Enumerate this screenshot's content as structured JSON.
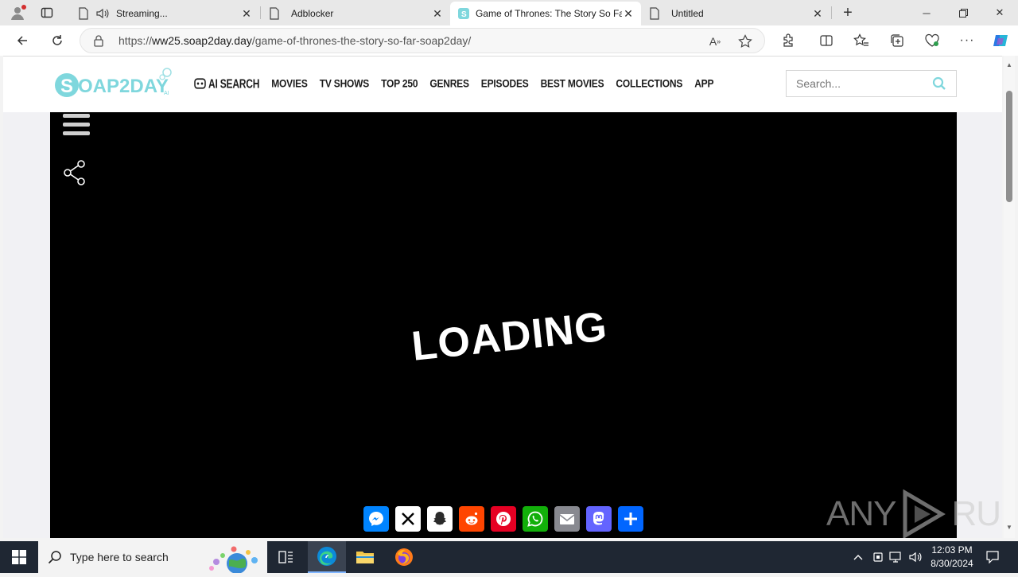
{
  "browser": {
    "tabs": [
      {
        "title": "Streaming...",
        "active": false
      },
      {
        "title": "Adblocker",
        "active": false
      },
      {
        "title": "Game of Thrones: The Story So Fa",
        "active": true
      },
      {
        "title": "Untitled",
        "active": false
      }
    ],
    "url_prefix": "https://",
    "url_domain": "ww25.soap2day.day",
    "url_path": "/game-of-thrones-the-story-so-far-soap2day/",
    "read_aloud_label": "A"
  },
  "site": {
    "logo_text": "SOAP2DAY",
    "logo_suffix": "AI",
    "nav": [
      "AI SEARCH",
      "MOVIES",
      "TV SHOWS",
      "TOP 250",
      "GENRES",
      "EPISODES",
      "BEST MOVIES",
      "COLLECTIONS",
      "APP"
    ],
    "search_placeholder": "Search..."
  },
  "player": {
    "loading_text": "LOADING",
    "share_buttons": [
      {
        "name": "messenger",
        "color": "#0084ff"
      },
      {
        "name": "x",
        "color": "#000000"
      },
      {
        "name": "snapchat",
        "color": "#2a2a2a"
      },
      {
        "name": "reddit",
        "color": "#ff4500"
      },
      {
        "name": "pinterest",
        "color": "#e60023"
      },
      {
        "name": "whatsapp",
        "color": "#12af0a"
      },
      {
        "name": "email",
        "color": "#888990"
      },
      {
        "name": "mastodon",
        "color": "#6364ff"
      },
      {
        "name": "share",
        "color": "#0166ff"
      }
    ]
  },
  "watermark": {
    "left": "ANY",
    "right": "RUN"
  },
  "taskbar": {
    "search_placeholder": "Type here to search",
    "time": "12:03 PM",
    "date": "8/30/2024"
  }
}
